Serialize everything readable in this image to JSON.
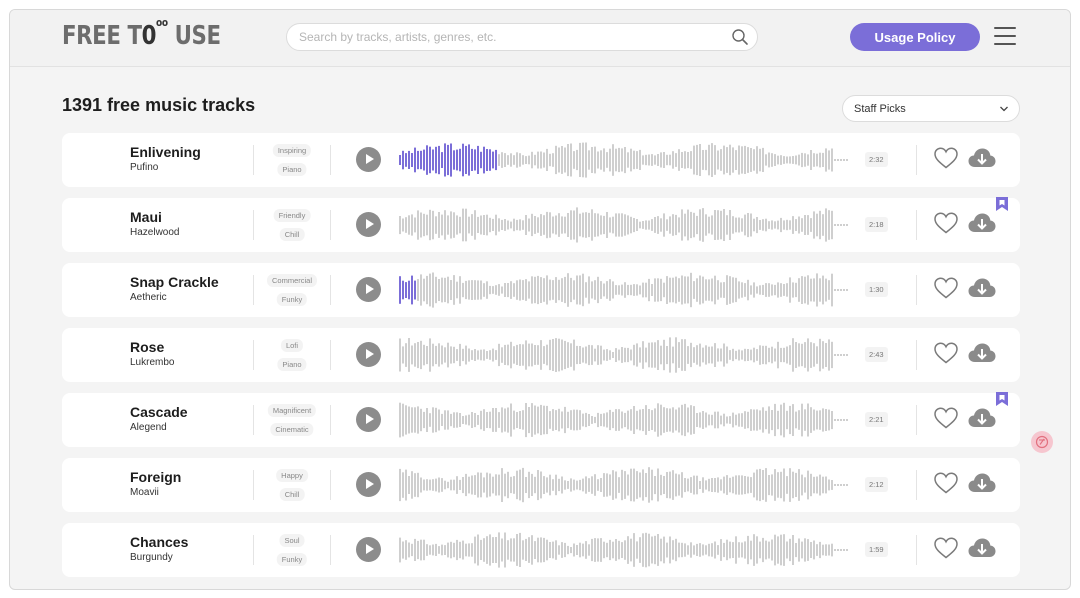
{
  "header": {
    "logo_prefix": "FREE T",
    "logo_zero": "0",
    "logo_sup": "oo",
    "logo_suffix": " USE",
    "search_placeholder": "Search by tracks, artists, genres, etc.",
    "search_icon": "search-icon",
    "policy_label": "Usage Policy",
    "menu_icon": "hamburger-menu-icon"
  },
  "main": {
    "count_title": "1391 free music tracks",
    "sort_value": "Staff Picks"
  },
  "colors": {
    "accent": "#7b6ed8",
    "wave_idle": "#cfcfcf",
    "wave_played": "#7b6ed8"
  },
  "tracks": [
    {
      "title": "Enlivening",
      "artist": "Pufino",
      "tags": [
        "Inspiring",
        "Piano"
      ],
      "duration": "2:32",
      "progress": 0.22,
      "bookmarked": false,
      "seed": 3
    },
    {
      "title": "Maui",
      "artist": "Hazelwood",
      "tags": [
        "Friendly",
        "Chill"
      ],
      "duration": "2:18",
      "progress": 0,
      "bookmarked": true,
      "seed": 7
    },
    {
      "title": "Snap Crackle",
      "artist": "Aetheric",
      "tags": [
        "Commercial",
        "Funky"
      ],
      "duration": "1:30",
      "progress": 0.04,
      "bookmarked": false,
      "seed": 11
    },
    {
      "title": "Rose",
      "artist": "Lukrembo",
      "tags": [
        "Lofi",
        "Piano"
      ],
      "duration": "2:43",
      "progress": 0,
      "bookmarked": false,
      "seed": 17
    },
    {
      "title": "Cascade",
      "artist": "Alegend",
      "tags": [
        "Magnificent",
        "Cinematic"
      ],
      "duration": "2:21",
      "progress": 0,
      "bookmarked": true,
      "seed": 23
    },
    {
      "title": "Foreign",
      "artist": "Moavii",
      "tags": [
        "Happy",
        "Chill"
      ],
      "duration": "2:12",
      "progress": 0,
      "bookmarked": false,
      "seed": 29
    },
    {
      "title": "Chances",
      "artist": "Burgundy",
      "tags": [
        "Soul",
        "Funky"
      ],
      "duration": "1:59",
      "progress": 0,
      "bookmarked": false,
      "seed": 31
    }
  ]
}
